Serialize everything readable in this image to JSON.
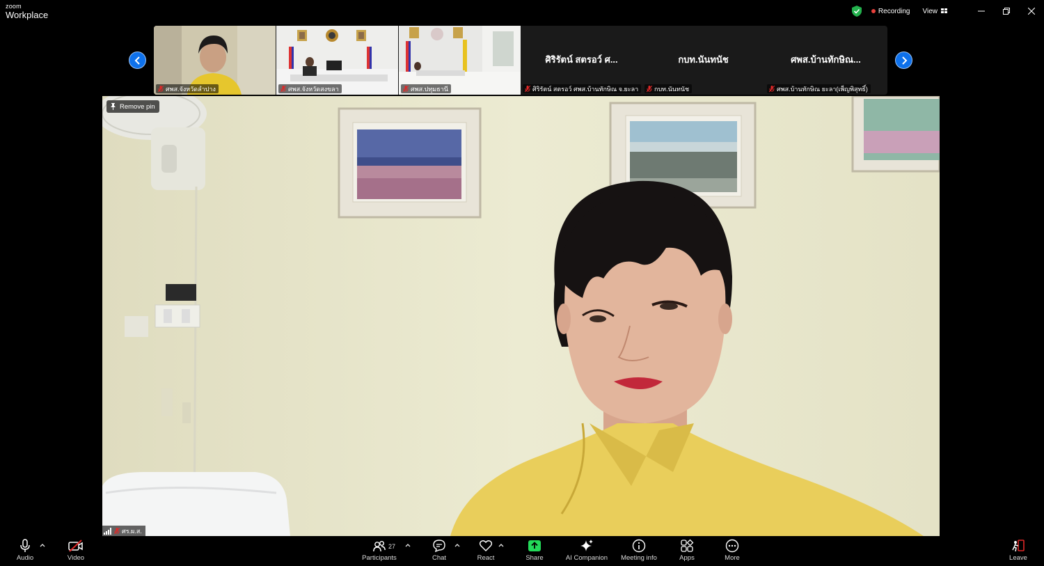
{
  "app": {
    "brand_small": "zoom",
    "brand_name": "Workplace"
  },
  "titlebar": {
    "recording_label": "Recording",
    "view_label": "View"
  },
  "thumbnails": [
    {
      "label": "ศพส.จังหวัดลำปาง",
      "type": "video"
    },
    {
      "label": "ศพส.จังหวัดสงขลา",
      "type": "video"
    },
    {
      "label": "ศพส.ปทุมธานี",
      "type": "video"
    },
    {
      "label": "ศิริรัตน์ สตรอว์ ศพส.บ้านทักษิณ จ.ยะลา",
      "display_name": "ศิริรัตน์ สตรอว์ ศ...",
      "type": "name"
    },
    {
      "label": "กบท.นันทนัช",
      "display_name": "กบท.นันทนัช",
      "type": "name"
    },
    {
      "label": "ศพส.บ้านทักษิณ ยะลา(เพ็ญพิสุทธิ์)",
      "display_name": "ศพส.บ้านทักษิณ...",
      "type": "name"
    }
  ],
  "main_video": {
    "remove_pin_label": "Remove pin",
    "participant_name": "ศร.ผ.ส."
  },
  "toolbar": {
    "audio": "Audio",
    "video": "Video",
    "participants": "Participants",
    "participants_count": "27",
    "chat": "Chat",
    "react": "React",
    "share": "Share",
    "ai_companion": "AI Companion",
    "meeting_info": "Meeting info",
    "apps": "Apps",
    "more": "More",
    "leave": "Leave"
  },
  "colors": {
    "accent_blue": "#0e71eb",
    "share_green": "#23d959",
    "recording_red": "#e8403b",
    "leave_red": "#e02828",
    "shield_green": "#23b14d"
  }
}
